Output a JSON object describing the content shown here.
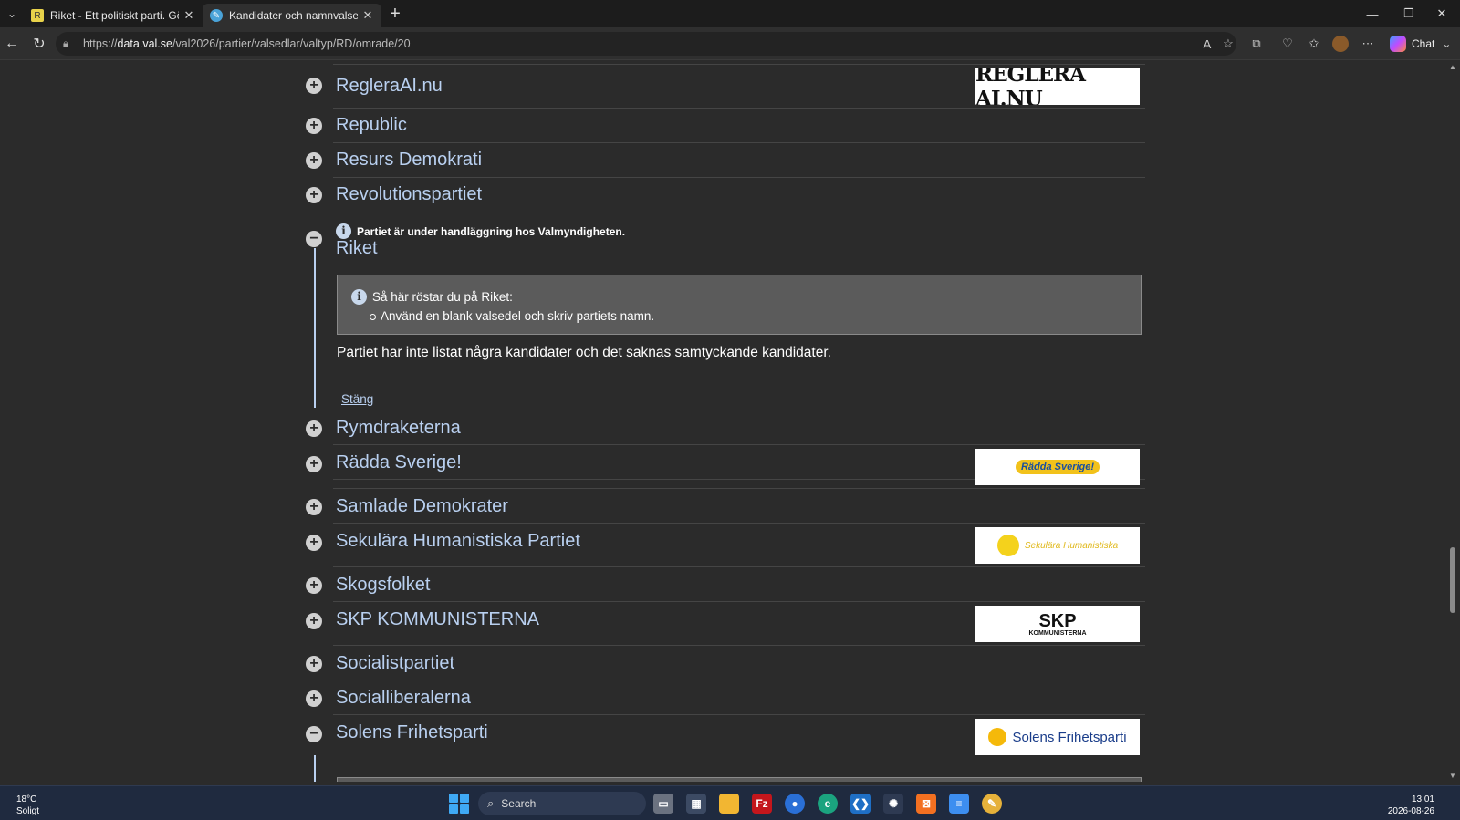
{
  "browser": {
    "tabs": [
      {
        "label": "Riket - Ett politiskt parti. Gör Sverig",
        "active": false
      },
      {
        "label": "Kandidater och namnvalsedlar | Va",
        "active": true
      }
    ],
    "new_tab": "+",
    "url_prefix": "https://",
    "url_host": "data.val.se",
    "url_path": "/val2026/partier/valsedlar/valtyp/RD/omrade/20",
    "chat_label": "Chat"
  },
  "parties": [
    {
      "name": "RegleraAI.nu",
      "logo_text": "REGLERA AI.NU"
    },
    {
      "name": "Republic"
    },
    {
      "name": "Resurs Demokrati"
    },
    {
      "name": "Revolutionspartiet"
    },
    {
      "name": "Riket",
      "expanded": true
    },
    {
      "name": "Rymdraketerna"
    },
    {
      "name": "Rädda Sverige!",
      "logo_text": "Rädda Sverige!"
    },
    {
      "name": "Samlade Demokrater"
    },
    {
      "name": "Sekulära Humanistiska Partiet",
      "logo_text": "Sekulära Humanistiska"
    },
    {
      "name": "Skogsfolket"
    },
    {
      "name": "SKP KOMMUNISTERNA",
      "logo_text": "SKP",
      "logo_sub": "KOMMUNISTERNA"
    },
    {
      "name": "Socialistpartiet"
    },
    {
      "name": "Socialliberalerna"
    },
    {
      "name": "Solens Frihetsparti",
      "logo_text": "Solens Frihetsparti",
      "expanded": true
    }
  ],
  "riket": {
    "notice": "Partiet är under handläggning hos Valmyndigheten.",
    "how_title": "Så här röstar du på Riket:",
    "how_item": "Använd en blank valsedel och skriv partiets namn.",
    "no_candidates": "Partiet har inte listat några kandidater och det saknas samtyckande kandidater.",
    "close": "Stäng"
  },
  "taskbar": {
    "temp": "18°C",
    "weather": "Soligt",
    "search": "Search",
    "time": "13:01",
    "date": "2026-08-26"
  },
  "colors": {
    "link": "#b9d0f0",
    "background": "#2b2b2b",
    "howbox": "#5b5b5b"
  }
}
